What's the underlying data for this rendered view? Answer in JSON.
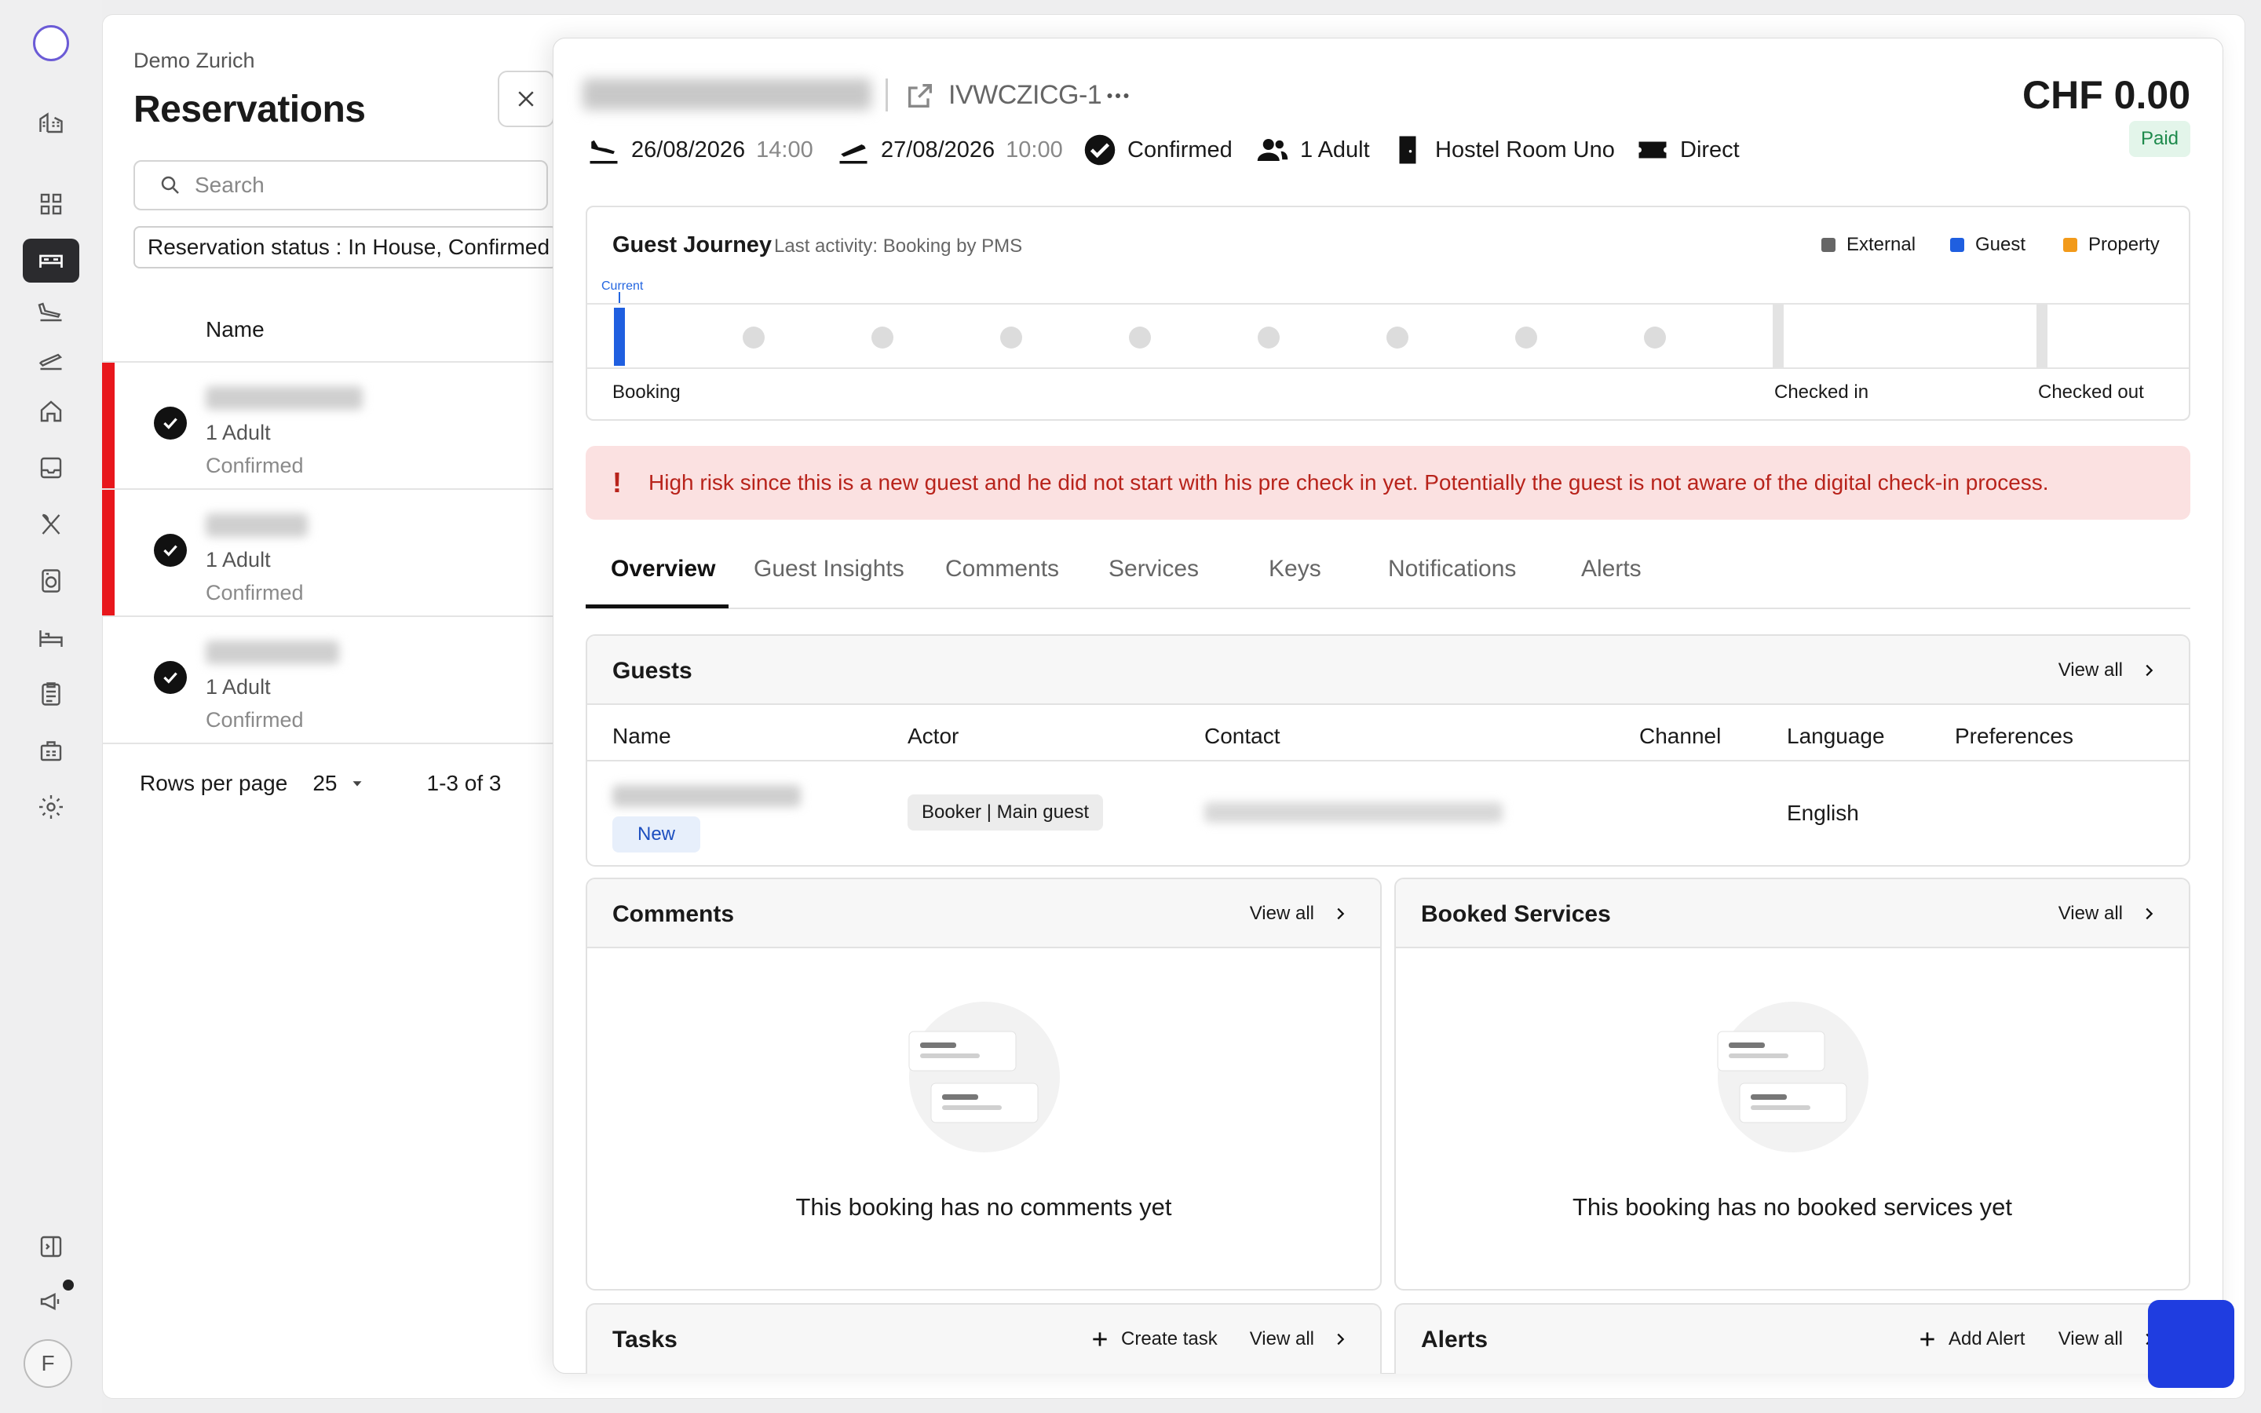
{
  "nav": {
    "icons": [
      "home-icon",
      "dashboard-icon",
      "reservations-icon",
      "arrivals-icon",
      "departures-icon",
      "house-icon",
      "inbox-icon",
      "restaurant-icon",
      "housekeeping-icon",
      "rooms-icon",
      "tasks-icon",
      "reports-icon",
      "settings-icon"
    ],
    "bottom": [
      "collapse-icon",
      "announcements-icon"
    ],
    "avatar_initial": "F"
  },
  "list": {
    "org": "Demo Zurich",
    "title": "Reservations",
    "search_placeholder": "Search",
    "filter_chip": "Reservation status : In House, Confirmed",
    "column_name": "Name",
    "rows": [
      {
        "guests": "1 Adult",
        "status": "Confirmed",
        "flag": "#e8171c"
      },
      {
        "guests": "1 Adult",
        "status": "Confirmed",
        "flag": "#e8171c"
      },
      {
        "guests": "1 Adult",
        "status": "Confirmed",
        "flag": ""
      }
    ],
    "pager": {
      "rows_label": "Rows per page",
      "rows_value": "25",
      "range": "1-3 of 3"
    }
  },
  "detail": {
    "reservation_id": "IVWCZICG-1",
    "price": "CHF 0.00",
    "payment_status": "Paid",
    "arrival_date": "26/08/2026",
    "arrival_time": "14:00",
    "departure_date": "27/08/2026",
    "departure_time": "10:00",
    "status": "Confirmed",
    "guests": "1 Adult",
    "room": "Hostel Room Uno",
    "channel": "Direct",
    "journey": {
      "title": "Guest Journey",
      "last_activity": "Last activity: Booking by PMS",
      "legend": [
        {
          "label": "External",
          "color": "#666666"
        },
        {
          "label": "Guest",
          "color": "#1f5fe0"
        },
        {
          "label": "Property",
          "color": "#f29a1a"
        }
      ],
      "current_label": "Current",
      "stages": [
        "Booking",
        "Checked in",
        "Checked out"
      ]
    },
    "alert": "High risk since this is a new guest and he did not start with his pre check in yet. Potentially the guest is not aware of the digital check-in process.",
    "tabs": [
      "Overview",
      "Guest Insights",
      "Comments",
      "Services",
      "Keys",
      "Notifications",
      "Alerts"
    ],
    "guests_card": {
      "title": "Guests",
      "view_all": "View all",
      "columns": [
        "Name",
        "Actor",
        "Contact",
        "Channel",
        "Language",
        "Preferences"
      ],
      "row": {
        "tag": "New",
        "actor": "Booker | Main guest",
        "language": "English"
      }
    },
    "comments_card": {
      "title": "Comments",
      "view_all": "View all",
      "empty": "This booking has no comments yet"
    },
    "services_card": {
      "title": "Booked Services",
      "view_all": "View all",
      "empty": "This booking has no booked services yet"
    },
    "tasks_card": {
      "title": "Tasks",
      "create": "Create task",
      "view_all": "View all"
    },
    "alerts_card": {
      "title": "Alerts",
      "create": "Add Alert",
      "view_all": "View all"
    }
  }
}
